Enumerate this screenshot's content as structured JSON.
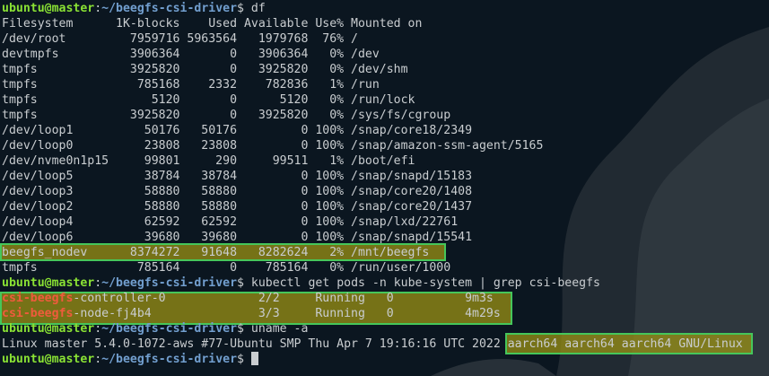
{
  "prompt": {
    "user_host": "ubuntu@master",
    "sep": ":",
    "path": "~/beegfs-csi-driver",
    "symbol": "$ "
  },
  "commands": {
    "df": "df",
    "kubectl": "kubectl get pods -n kube-system | grep csi-beegfs",
    "uname": "uname -a"
  },
  "df": {
    "header": "Filesystem      1K-blocks    Used Available Use% Mounted on",
    "rows": [
      "/dev/root         7959716 5963564   1979768  76% /",
      "devtmpfs          3906364       0   3906364   0% /dev",
      "tmpfs             3925820       0   3925820   0% /dev/shm",
      "tmpfs              785168    2332    782836   1% /run",
      "tmpfs                5120       0      5120   0% /run/lock",
      "tmpfs             3925820       0   3925820   0% /sys/fs/cgroup",
      "/dev/loop1          50176   50176         0 100% /snap/core18/2349",
      "/dev/loop0          23808   23808         0 100% /snap/amazon-ssm-agent/5165",
      "/dev/nvme0n1p15     99801     290     99511   1% /boot/efi",
      "/dev/loop5          38784   38784         0 100% /snap/snapd/15183",
      "/dev/loop3          58880   58880         0 100% /snap/core20/1408",
      "/dev/loop2          58880   58880         0 100% /snap/core20/1437",
      "/dev/loop4          62592   62592         0 100% /snap/lxd/22761",
      "/dev/loop6          39680   39680         0 100% /snap/snapd/15541",
      "beegfs_nodev      8374272   91648   8282624   2% /mnt/beegfs",
      "tmpfs              785164       0    785164   0% /run/user/1000"
    ]
  },
  "pods": [
    {
      "match": "csi-beegfs",
      "rest": "-controller-0             2/2     Running   0          9m3s"
    },
    {
      "match": "csi-beegfs",
      "rest": "-node-fj4b4               3/3     Running   0          4m29s"
    }
  ],
  "uname": {
    "prefix": "Linux master 5.4.0-1072-aws #77-Ubuntu SMP Thu Apr 7 19:16:16 UTC 2022 ",
    "arch": "aarch64 aarch64 aarch64 GNU/Linux"
  },
  "colors": {
    "user": "#8ae234",
    "path": "#729fcf",
    "match": "#ef5b3c",
    "highlight_border": "#46c65a"
  }
}
